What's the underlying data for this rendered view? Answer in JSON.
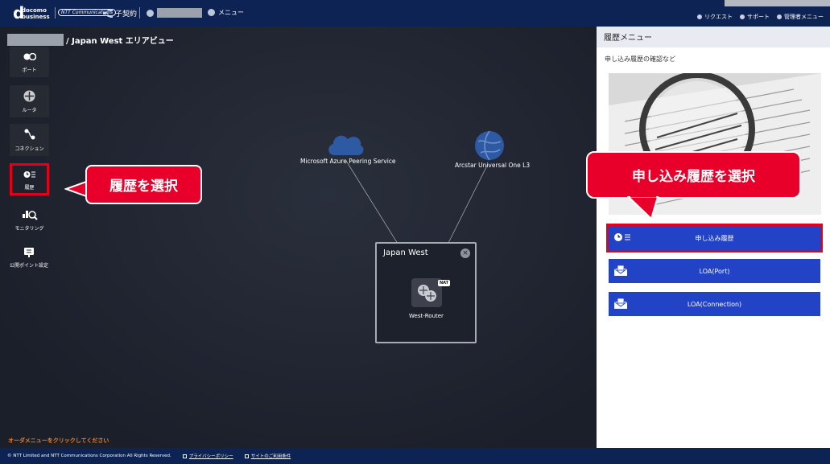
{
  "header": {
    "logo_mark": "d",
    "logo_line1": "docomo",
    "logo_line2": "business",
    "ntt_logo": "NTT Communications",
    "contract_label": "子契約",
    "menu_label": "メニュー",
    "links": [
      {
        "label": "リクエスト",
        "icon": "person-icon"
      },
      {
        "label": "サポート",
        "icon": "help-icon"
      },
      {
        "label": "管理者メニュー",
        "icon": "gear-icon"
      }
    ]
  },
  "breadcrumb": {
    "text": "/ Japan West エリアビュー"
  },
  "sidebar": {
    "items": [
      {
        "label": "ポート",
        "icon": "port-icon"
      },
      {
        "label": "ルータ",
        "icon": "router-icon"
      },
      {
        "label": "コネクション",
        "icon": "connection-icon"
      },
      {
        "label": "履歴",
        "icon": "history-icon"
      },
      {
        "label": "モニタリング",
        "icon": "monitoring-icon"
      },
      {
        "label": "公開ポイント設定",
        "icon": "public-point-icon"
      }
    ]
  },
  "callouts": {
    "left": "履歴を選択",
    "right": "申し込み履歴を選択"
  },
  "topology": {
    "nodes": [
      {
        "label": "Microsoft Azure Peering Service",
        "icon": "cloud-icon"
      },
      {
        "label": "Arcstar Universal One L3",
        "icon": "globe-icon"
      }
    ],
    "area": {
      "title": "Japan West",
      "router_label": "West-Router",
      "badge": "NAT"
    }
  },
  "order_hint": "オーダメニューをクリックしてください",
  "panel": {
    "title": "履歴メニュー",
    "subtitle": "申し込み履歴の確認など",
    "buttons": [
      {
        "label": "申し込み履歴",
        "icon": "history-list-icon"
      },
      {
        "label": "LOA(Port)",
        "icon": "envelope-icon"
      },
      {
        "label": "LOA(Connection)",
        "icon": "envelope-icon"
      }
    ]
  },
  "footer": {
    "copyright": "© NTT Limited and NTT Communications Corporation All Rights Reserved.",
    "privacy": "プライバシーポリシー",
    "terms": "サイトのご利用条件"
  },
  "colors": {
    "header_bg": "#0d2354",
    "accent_blue": "#2343c7",
    "highlight_red": "#e4001a"
  }
}
